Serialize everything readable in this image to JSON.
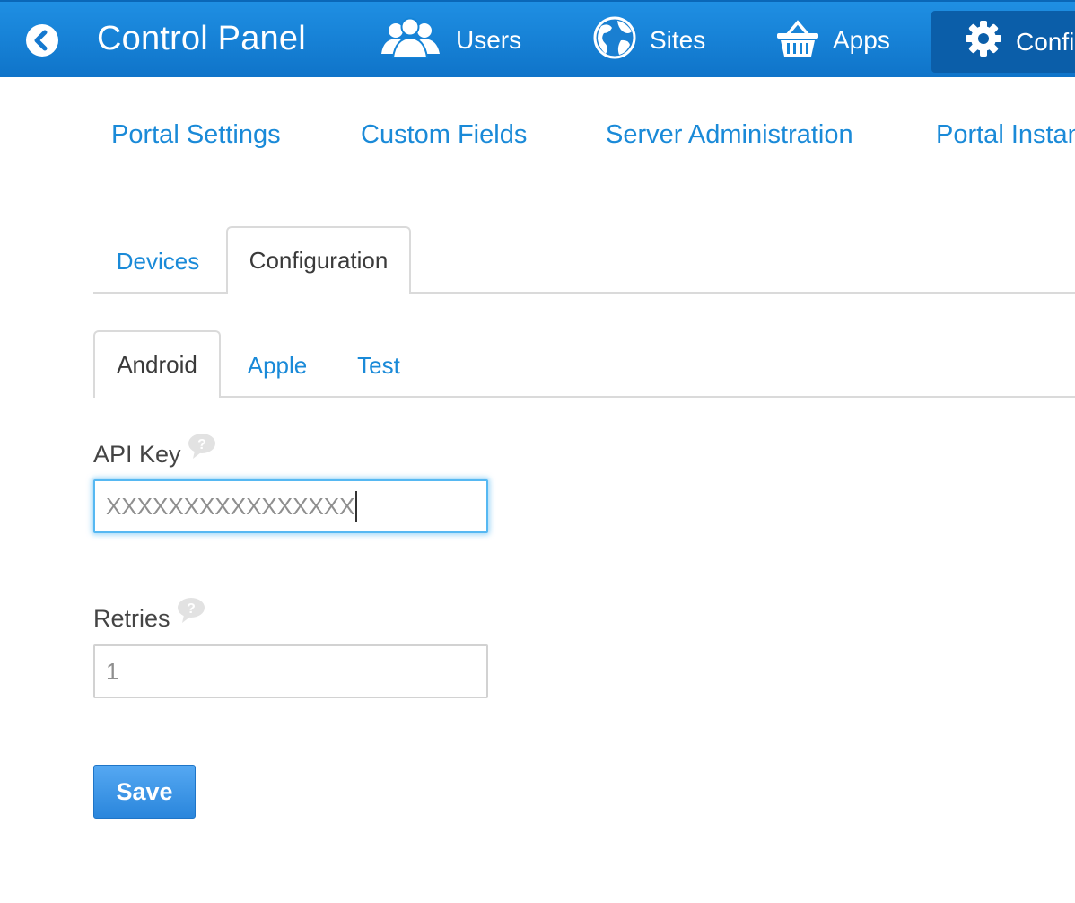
{
  "header": {
    "back_icon": "chevron-left-circle-icon",
    "title": "Control Panel",
    "nav": [
      {
        "label": "Users",
        "icon": "users-icon"
      },
      {
        "label": "Sites",
        "icon": "globe-icon"
      },
      {
        "label": "Apps",
        "icon": "basket-icon"
      },
      {
        "label": "Configuration",
        "icon": "gear-icon",
        "active": true
      }
    ],
    "colors": {
      "bar": "#1484d8",
      "active": "#0b5ea9"
    }
  },
  "subnav": {
    "items": [
      "Portal Settings",
      "Custom Fields",
      "Server Administration",
      "Portal Instances"
    ]
  },
  "tabs": {
    "primary": [
      {
        "label": "Devices",
        "active": false
      },
      {
        "label": "Configuration",
        "active": true
      }
    ],
    "secondary": [
      {
        "label": "Android",
        "active": true
      },
      {
        "label": "Apple",
        "active": false
      },
      {
        "label": "Test",
        "active": false
      }
    ]
  },
  "form": {
    "api_key": {
      "label": "API Key",
      "value": "XXXXXXXXXXXXXXXX",
      "help_icon": "help-bubble-icon"
    },
    "retries": {
      "label": "Retries",
      "value": "1",
      "help_icon": "help-bubble-icon"
    },
    "save_label": "Save"
  },
  "colors": {
    "link": "#1a8ad8",
    "focus": "#56b8f2",
    "button": "#3b94e4"
  }
}
